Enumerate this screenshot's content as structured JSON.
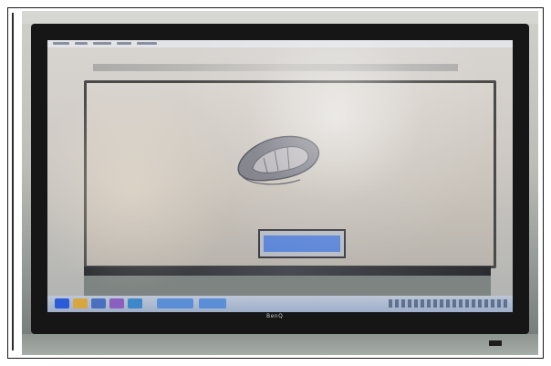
{
  "photo": {
    "description_free": true,
    "brand_text": "BenQ",
    "colors": {
      "bezel": "#161616",
      "screen": "#d3cfca",
      "taskbar": "#a9b8ce",
      "dialog_fill": "#5c86d8"
    }
  }
}
